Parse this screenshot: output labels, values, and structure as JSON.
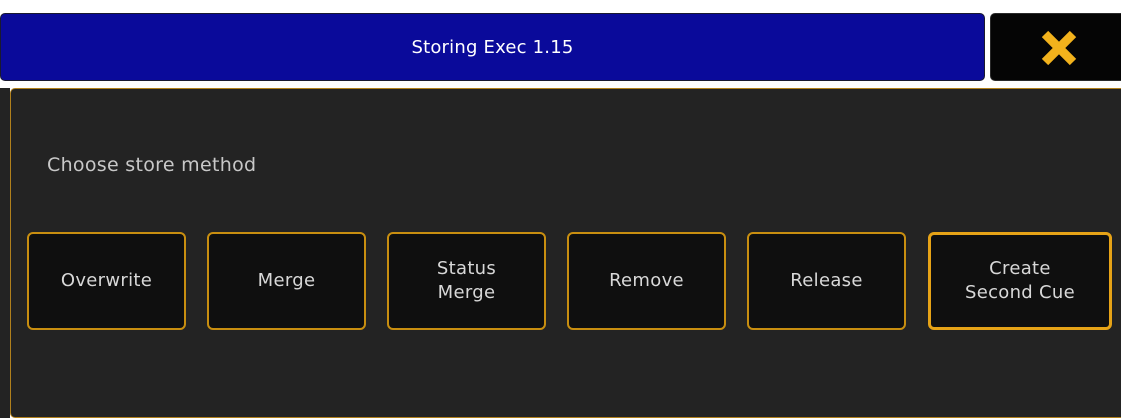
{
  "dialog": {
    "title": "Storing Exec 1.15",
    "close_icon": "close-x-icon",
    "prompt": "Choose store method",
    "methods": [
      {
        "label": "Overwrite"
      },
      {
        "label": "Merge"
      },
      {
        "label": "Status\nMerge"
      },
      {
        "label": "Remove"
      },
      {
        "label": "Release"
      },
      {
        "label": "Create\nSecond Cue"
      }
    ]
  },
  "colors": {
    "title_bar": "#0a0a9a",
    "accent_border": "#c88e10",
    "close_icon": "#f2b21c",
    "panel_bg": "#232323"
  }
}
